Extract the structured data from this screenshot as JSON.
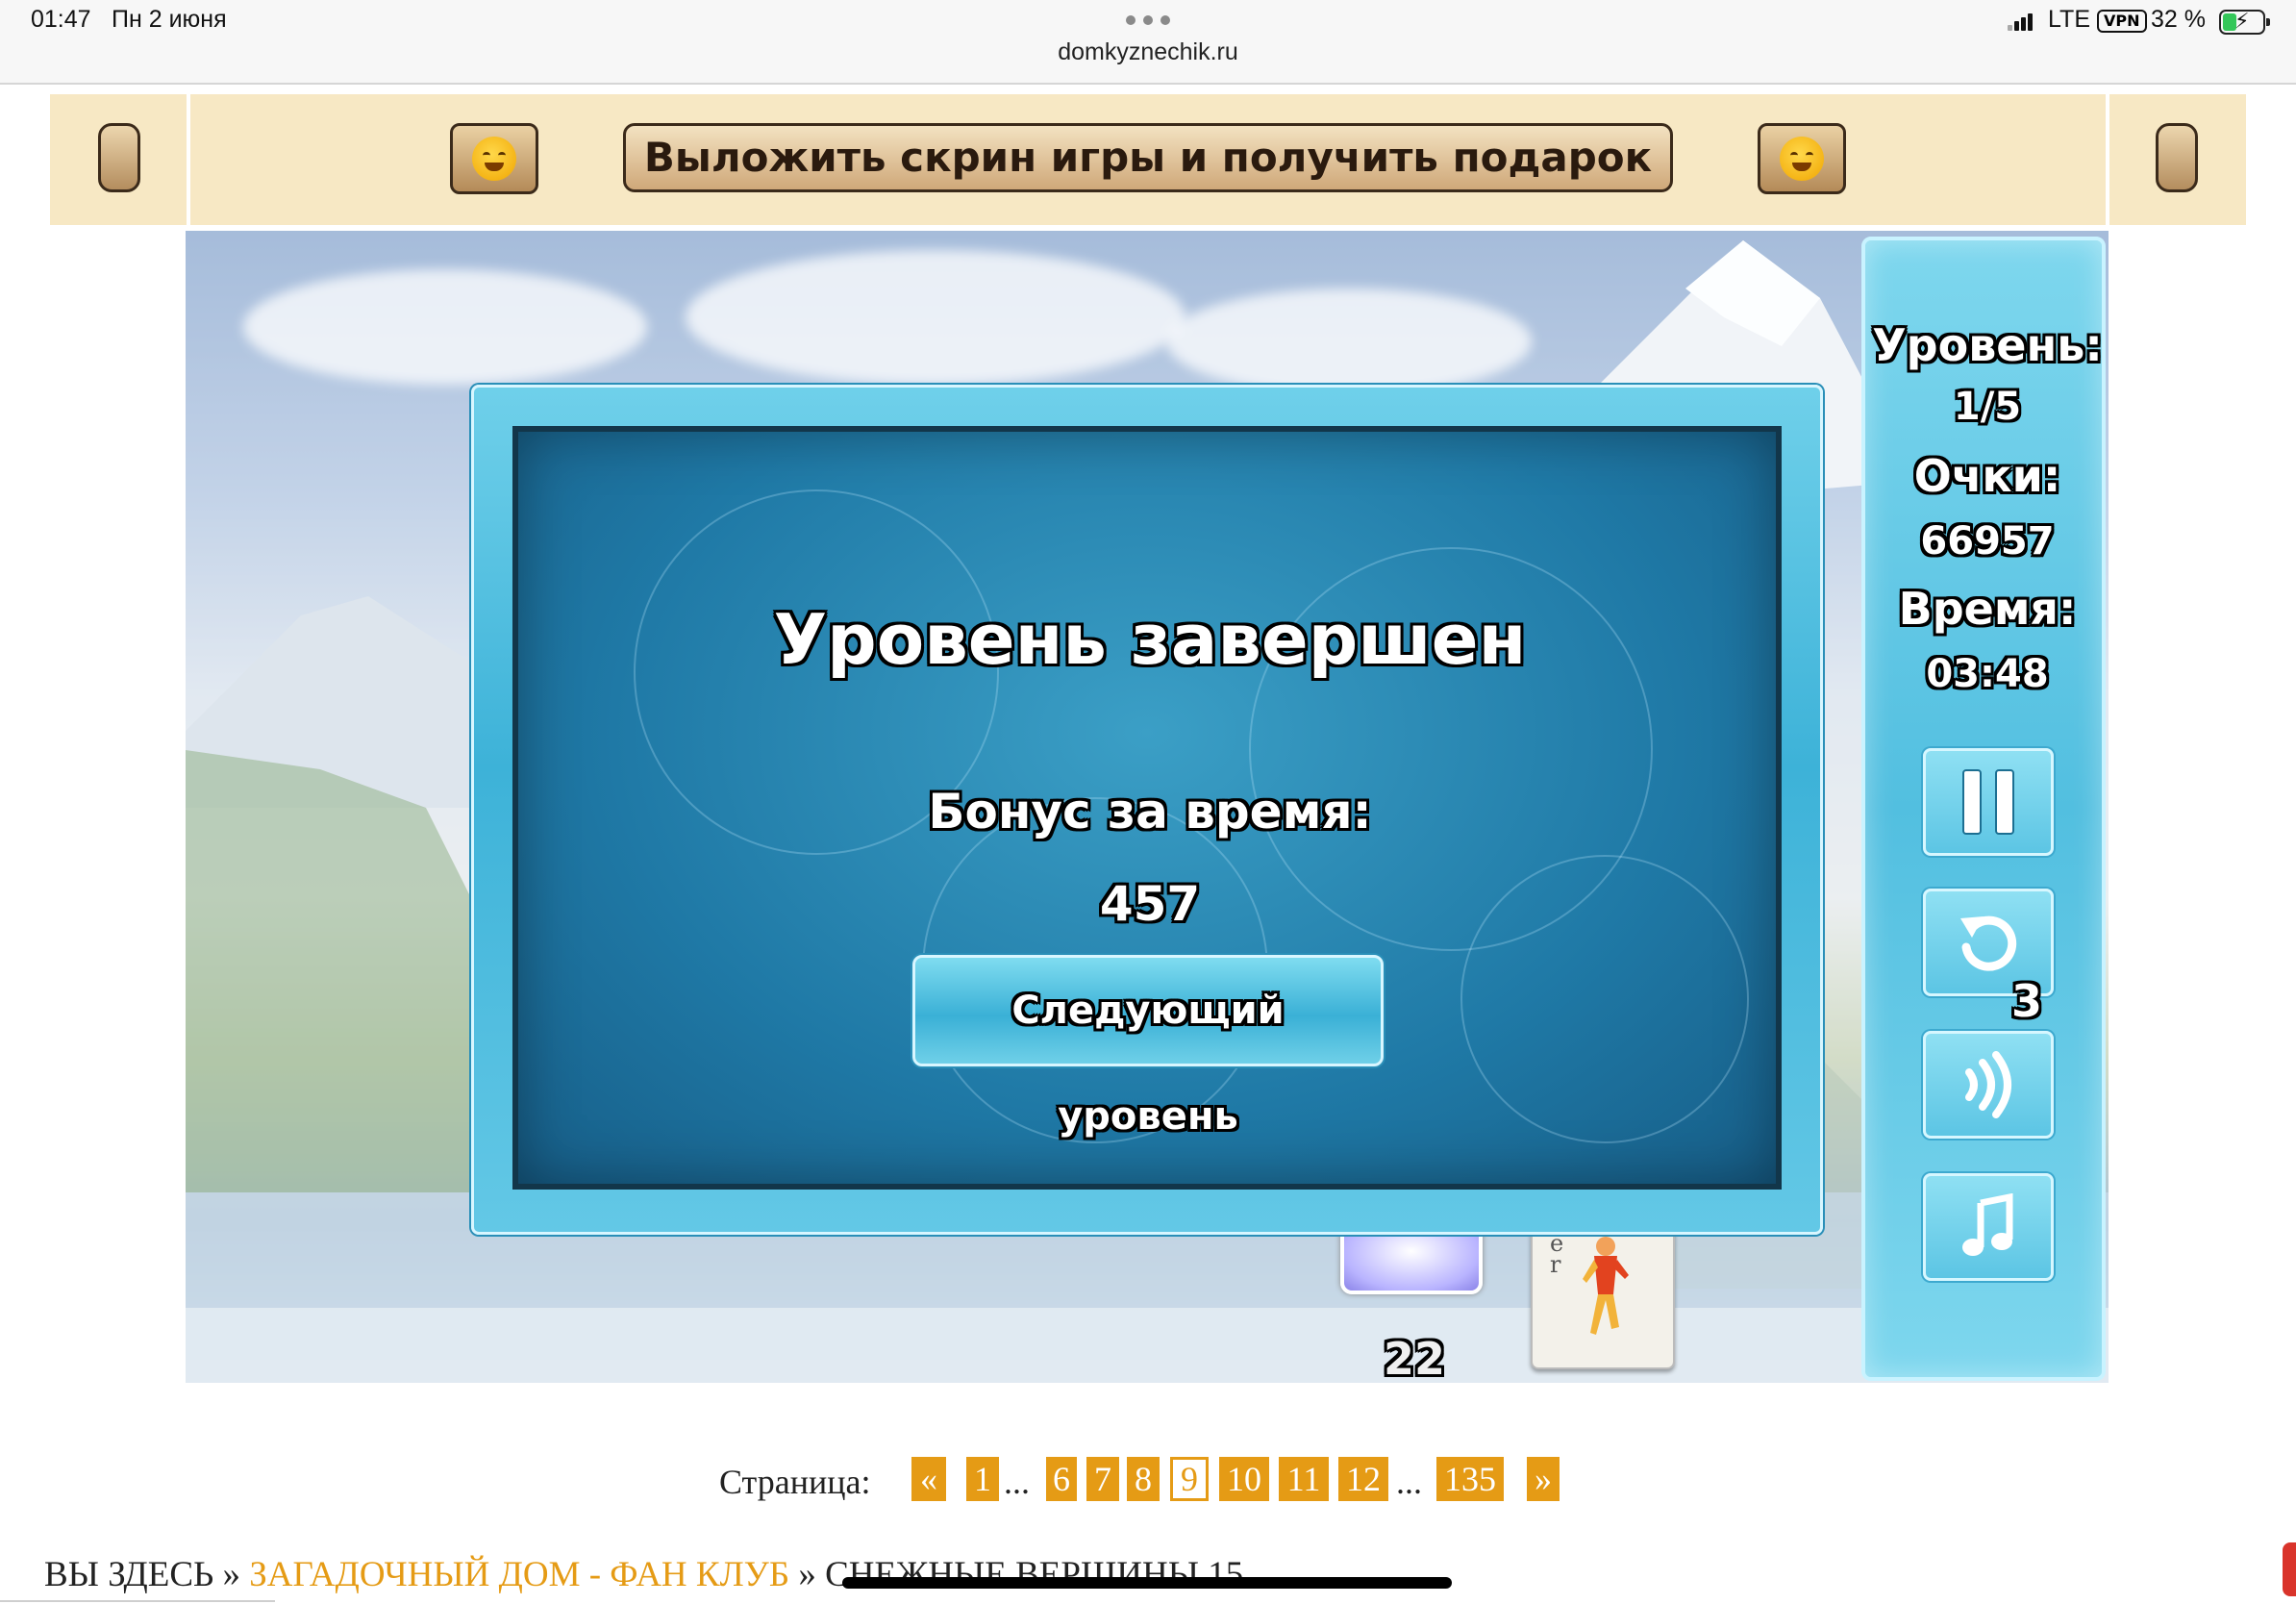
{
  "status_bar": {
    "time": "01:47",
    "date": "Пн 2 июня",
    "url": "domkyznechik.ru",
    "network": "LTE",
    "vpn": "VPN",
    "battery": "32 %"
  },
  "banner": {
    "button_label": "Выложить скрин игры и получить подарок",
    "left_emoji_icon": "hugging-face-icon",
    "right_emoji_icon": "hugging-face-icon"
  },
  "dialog": {
    "title": "Уровень завершен",
    "bonus_label": "Бонус за время:",
    "bonus_value": "457",
    "next_button": "Следующий уровень"
  },
  "side_panel": {
    "level_label": "Уровень:",
    "level_value": "1/5",
    "score_label": "Очки:",
    "score_value": "66957",
    "time_label": "Время:",
    "time_value": "03:48",
    "undo_count": "3",
    "buttons": [
      "pause-icon",
      "undo-icon",
      "sound-icon",
      "music-icon"
    ]
  },
  "board": {
    "deck_count": "22",
    "jester_card_letters": "e\nr"
  },
  "pagination": {
    "label": "Страница:",
    "prev": "«",
    "next": "»",
    "ellipsis": "...",
    "pages": [
      "1",
      "6",
      "7",
      "8",
      "9",
      "10",
      "11",
      "12",
      "135"
    ],
    "current": "9"
  },
  "breadcrumb": {
    "here": "ВЫ ЗДЕСЬ",
    "separator": "»",
    "section": "ЗАГАДОЧНЫЙ ДОМ - ФАН КЛУБ",
    "current": "СНЕЖНЫЕ ВЕРШИНЫ 15"
  },
  "colors": {
    "banner_bg": "#f7e8c4",
    "accent_orange": "#e59b15",
    "ice_blue": "#3db2d8"
  }
}
